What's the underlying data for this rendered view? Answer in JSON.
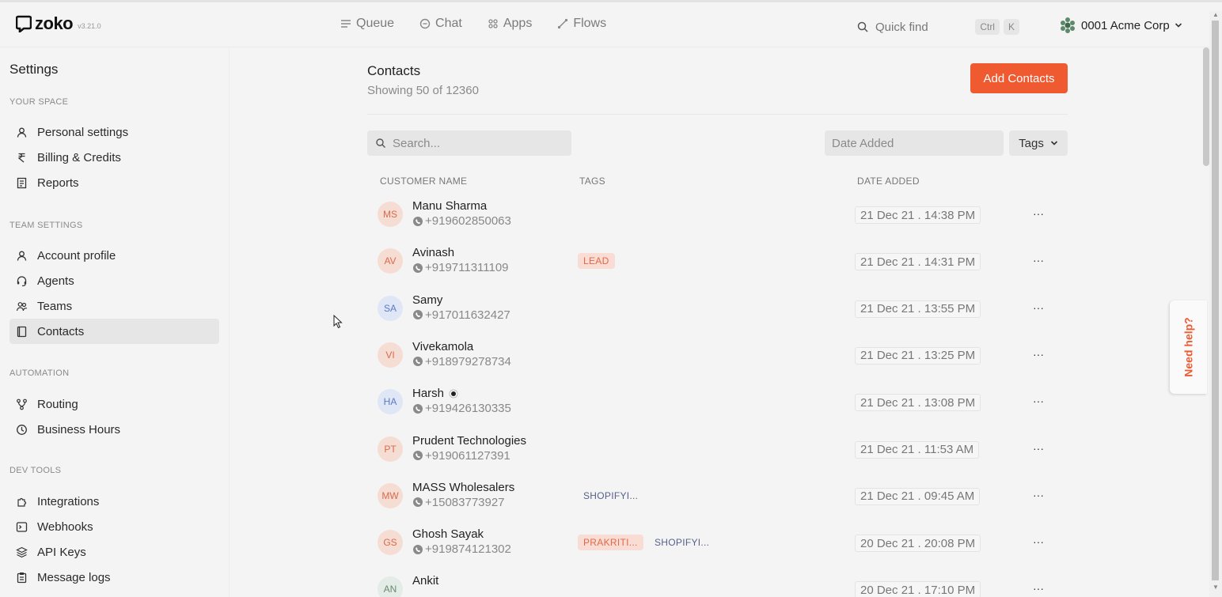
{
  "app": {
    "name": "zoko",
    "version": "v3.21.0"
  },
  "nav": [
    {
      "label": "Queue",
      "icon": "queue-icon"
    },
    {
      "label": "Chat",
      "icon": "chat-icon"
    },
    {
      "label": "Apps",
      "icon": "apps-icon"
    },
    {
      "label": "Flows",
      "icon": "flows-icon"
    }
  ],
  "quickfind": {
    "label": "Quick find",
    "key1": "Ctrl",
    "key2": "K"
  },
  "account": {
    "name": "0001 Acme Corp"
  },
  "sidebar": {
    "title": "Settings",
    "sections": {
      "your_space": "YOUR SPACE",
      "team_settings": "TEAM SETTINGS",
      "automation": "AUTOMATION",
      "dev_tools": "DEV TOOLS"
    },
    "items": {
      "personal": "Personal settings",
      "billing": "Billing & Credits",
      "reports": "Reports",
      "account_profile": "Account profile",
      "agents": "Agents",
      "teams": "Teams",
      "contacts": "Contacts",
      "routing": "Routing",
      "business_hours": "Business Hours",
      "integrations": "Integrations",
      "webhooks": "Webhooks",
      "api_keys": "API Keys",
      "message_logs": "Message logs"
    }
  },
  "main": {
    "title": "Contacts",
    "subtitle": "Showing 50 of 12360",
    "add_button": "Add Contacts",
    "search_placeholder": "Search...",
    "date_placeholder": "Date Added",
    "tags_filter": "Tags",
    "columns": {
      "name": "CUSTOMER NAME",
      "tags": "TAGS",
      "date": "DATE ADDED"
    }
  },
  "contacts": [
    {
      "initials": "MS",
      "name": "Manu Sharma",
      "phone": "+919602850063",
      "tags": [],
      "date": "21 Dec 21 . 14:38 PM",
      "avatar_bg": "#f6ddd3",
      "avatar_fg": "#d86a4c"
    },
    {
      "initials": "AV",
      "name": "Avinash",
      "phone": "+919711311109",
      "tags": [
        "LEAD"
      ],
      "date": "21 Dec 21 . 14:31 PM",
      "avatar_bg": "#f6ddd3",
      "avatar_fg": "#d86a4c"
    },
    {
      "initials": "SA",
      "name": "Samy",
      "phone": "+917011632427",
      "tags": [],
      "date": "21 Dec 21 . 13:55 PM",
      "avatar_bg": "#dfe6f6",
      "avatar_fg": "#5d79c4"
    },
    {
      "initials": "VI",
      "name": "Vivekamola",
      "phone": "+918979278734",
      "tags": [],
      "date": "21 Dec 21 . 13:25 PM",
      "avatar_bg": "#f6ddd3",
      "avatar_fg": "#d86a4c"
    },
    {
      "initials": "HA",
      "name": "Harsh",
      "phone": "+919426130335",
      "tags": [],
      "date": "21 Dec 21 . 13:08 PM",
      "avatar_bg": "#dfe6f6",
      "avatar_fg": "#5d79c4"
    },
    {
      "initials": "PT",
      "name": "Prudent Technologies",
      "phone": "+919061127391",
      "tags": [],
      "date": "21 Dec 21 . 11:53 AM",
      "avatar_bg": "#f6ddd3",
      "avatar_fg": "#d86a4c"
    },
    {
      "initials": "MW",
      "name": "MASS Wholesalers",
      "phone": "+15083773927",
      "tags": [
        "SHOPIFYI..."
      ],
      "date": "21 Dec 21 . 09:45 AM",
      "avatar_bg": "#f6ddd3",
      "avatar_fg": "#d86a4c"
    },
    {
      "initials": "GS",
      "name": "Ghosh Sayak",
      "phone": "+919874121302",
      "tags": [
        "PRAKRITI...",
        "SHOPIFYI..."
      ],
      "date": "20 Dec 21 . 20:08 PM",
      "avatar_bg": "#f6ddd3",
      "avatar_fg": "#d86a4c"
    },
    {
      "initials": "AN",
      "name": "Ankit",
      "phone": "",
      "tags": [],
      "date": "20 Dec 21 . 17:10 PM",
      "avatar_bg": "#e3ece6",
      "avatar_fg": "#6a8a73"
    }
  ],
  "help": {
    "label": "Need help?"
  },
  "colors": {
    "accent": "#f05a31",
    "background": "#f4f4f4"
  }
}
